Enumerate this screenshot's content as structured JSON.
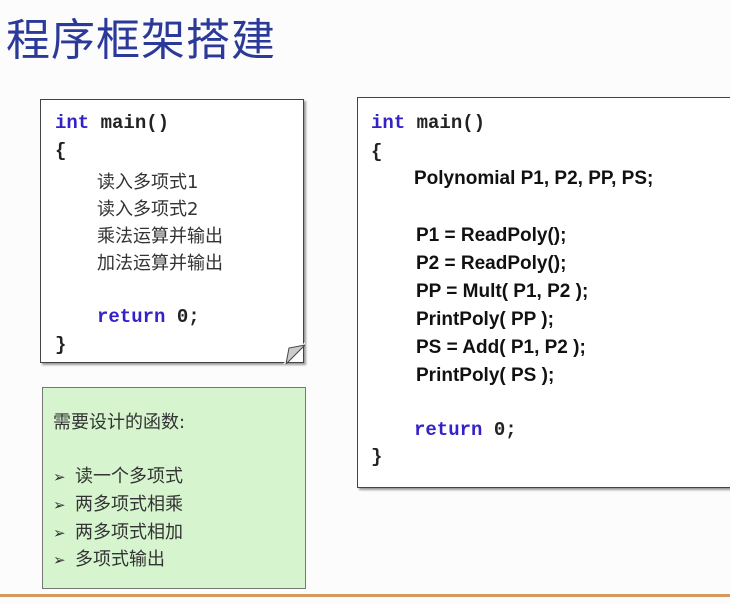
{
  "title": "程序框架搭建",
  "left_code": {
    "kw_int": "int",
    "main": "main()",
    "open_brace": "{",
    "steps": [
      "读入多项式1",
      "读入多项式2",
      "乘法运算并输出",
      "加法运算并输出"
    ],
    "kw_return": "return",
    "return_value": "0;",
    "close_brace": "}"
  },
  "right_code": {
    "kw_int": "int",
    "main": "main()",
    "open_brace": "{",
    "declaration": "Polynomial P1, P2, PP, PS;",
    "statements": [
      "P1 = ReadPoly();",
      "P2 = ReadPoly();",
      "PP = Mult( P1, P2 );",
      "PrintPoly( PP );",
      "PS = Add( P1, P2 );",
      "PrintPoly( PS );"
    ],
    "kw_return": "return",
    "return_value": "0;",
    "close_brace": "}"
  },
  "functions_box": {
    "heading": "需要设计的函数:",
    "bullet_icon": "arrow-bullet-icon",
    "items": [
      "读一个多项式",
      "两多项式相乘",
      "两多项式相加",
      "多项式输出"
    ]
  },
  "colors": {
    "title": "#2b3a99",
    "keyword": "#3422c9",
    "green_box": "#d6f5cf",
    "rule": "#d59a60"
  }
}
